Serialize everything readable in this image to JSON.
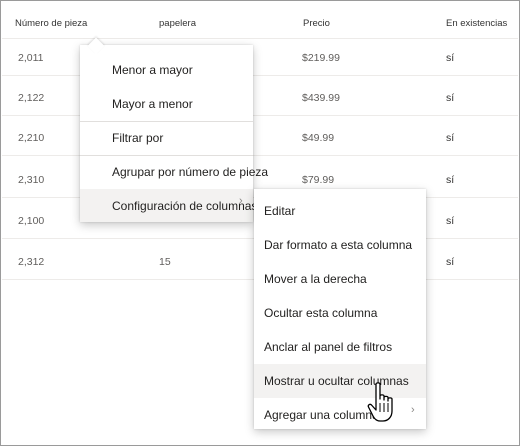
{
  "columns": [
    "Número de pieza",
    "papelera",
    "Precio",
    "En existencias"
  ],
  "rows": [
    {
      "part": "2,011",
      "bin": "",
      "price": "$219.99",
      "stock": "sí"
    },
    {
      "part": "2,122",
      "bin": "",
      "price": "$439.99",
      "stock": "sí"
    },
    {
      "part": "2,210",
      "bin": "",
      "price": "$49.99",
      "stock": "sí"
    },
    {
      "part": "2,310",
      "bin": "",
      "price": "$79.99",
      "stock": "sí"
    },
    {
      "part": "2,100",
      "bin": "",
      "price": "",
      "stock": "sí"
    },
    {
      "part": "2,312",
      "bin": "15",
      "price": "",
      "stock": "sí"
    }
  ],
  "column_menu": {
    "items": [
      "Menor a mayor",
      "Mayor a menor",
      "Filtrar por",
      "Agrupar por número de pieza",
      "Configuración de columnas"
    ]
  },
  "settings_menu": {
    "items": [
      "Editar",
      "Dar formato a esta columna",
      "Mover a la derecha",
      "Ocultar esta columna",
      "Anclar al panel de filtros",
      "Mostrar u ocultar columnas",
      "Agregar una columna"
    ]
  },
  "icons": {
    "chevron": "chevron-right-icon",
    "cursor": "hand-pointer-icon"
  },
  "colors": {
    "hover": "#f3f2f1",
    "text": "#201f1e",
    "muted": "#605e5c"
  }
}
